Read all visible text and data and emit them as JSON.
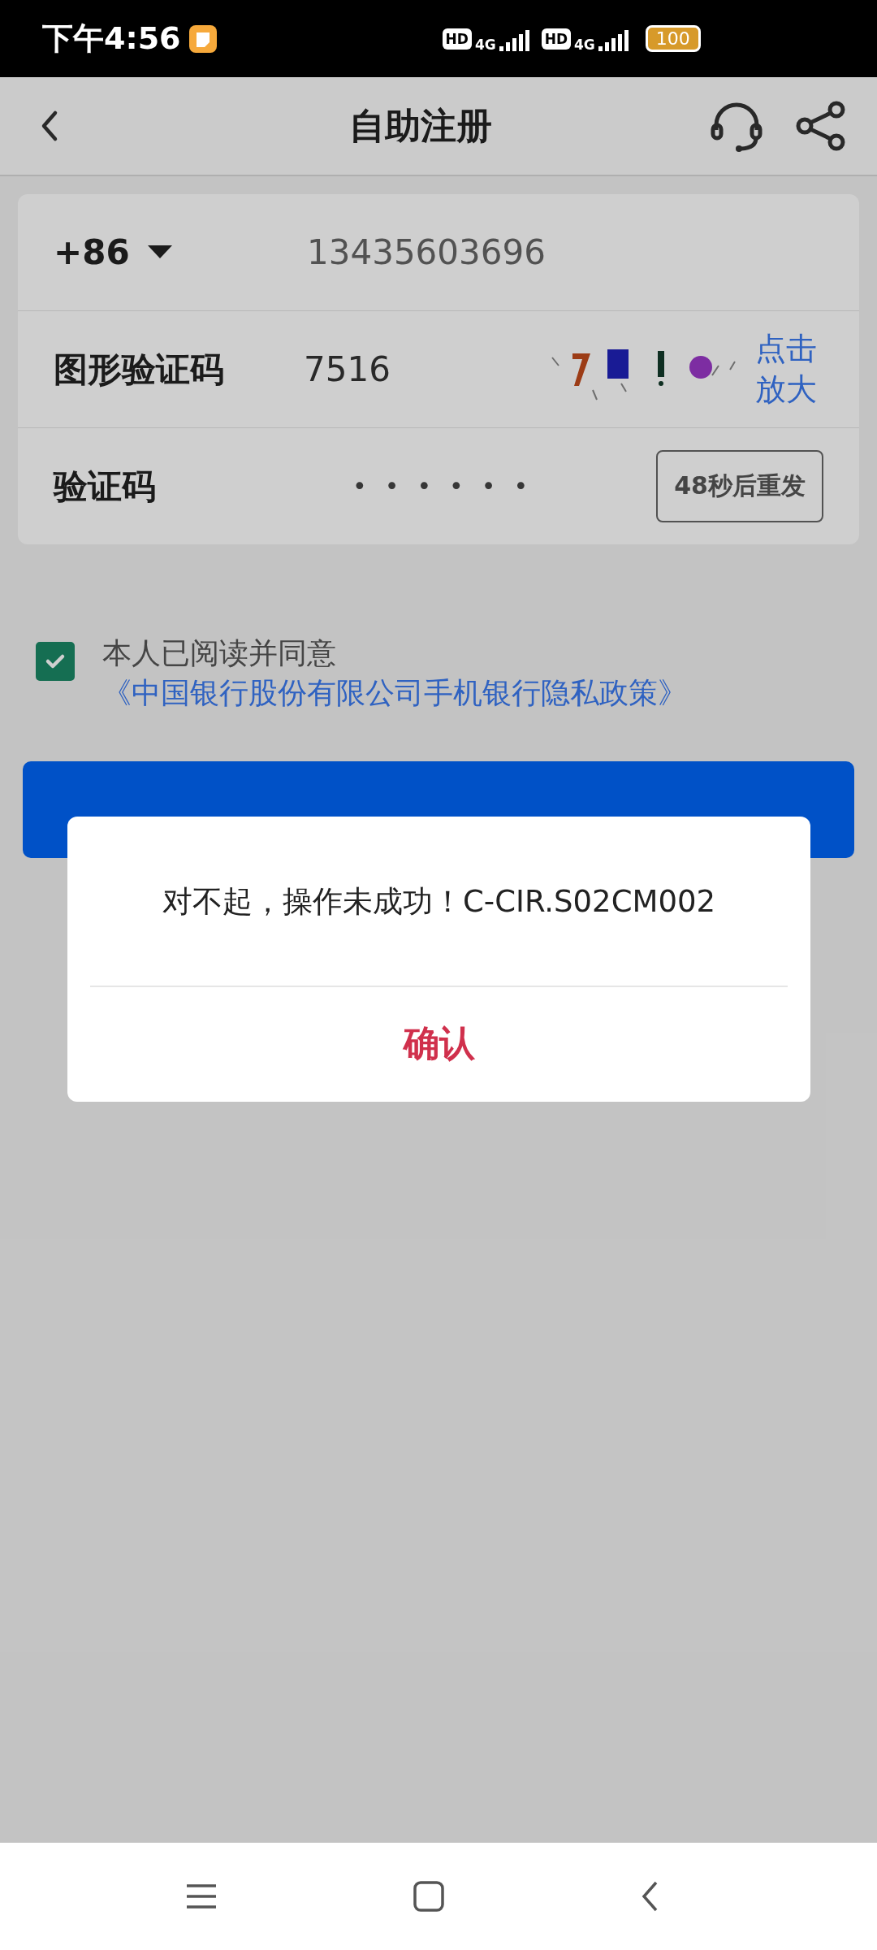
{
  "status_bar": {
    "time": "下午4:56",
    "sims": [
      {
        "hd": "HD",
        "network": "4G"
      },
      {
        "hd": "HD",
        "network": "4G"
      }
    ],
    "battery": "100"
  },
  "header": {
    "title": "自助注册"
  },
  "form": {
    "phone": {
      "country_code": "+86",
      "value": "13435603696"
    },
    "captcha": {
      "label": "图形验证码",
      "value": "7516",
      "enlarge_link": "点击放大"
    },
    "sms_code": {
      "label": "验证码",
      "value": "••••••",
      "resend_button": "48秒后重发"
    }
  },
  "agreement": {
    "checked": true,
    "text": "本人已阅读并同意",
    "link": "《中国银行股份有限公司手机银行隐私政策》"
  },
  "dialog": {
    "message": "对不起，操作未成功！C-CIR.S02CM002",
    "confirm_button": "确认"
  }
}
